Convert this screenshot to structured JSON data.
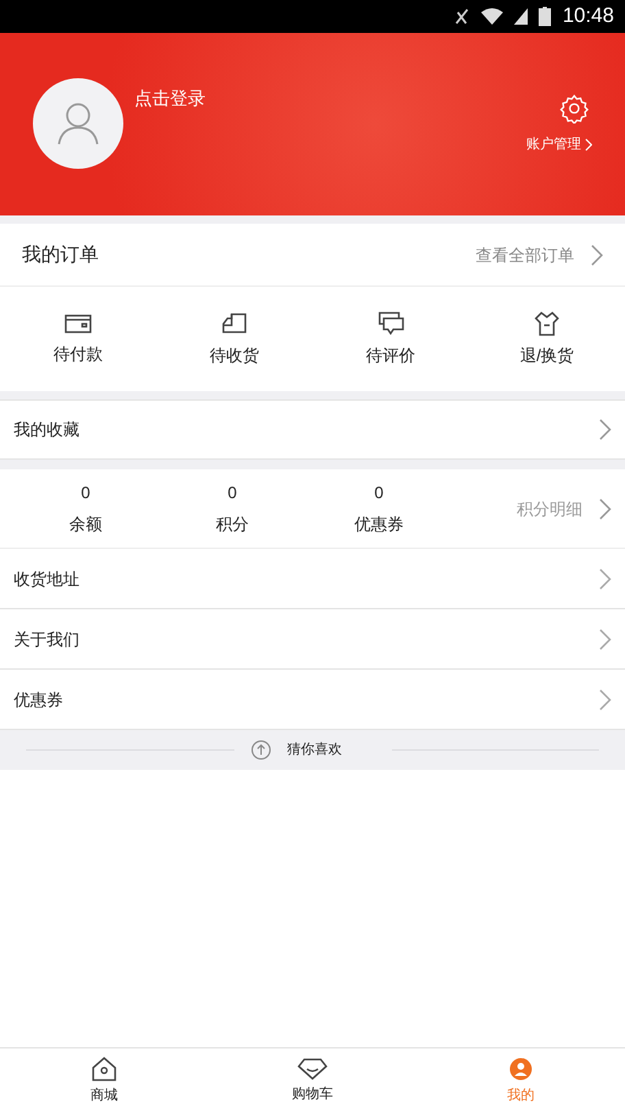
{
  "status_bar": {
    "time": "10:48"
  },
  "profile": {
    "login_text": "点击登录",
    "account_link": "账户管理"
  },
  "orders": {
    "title": "我的订单",
    "view_all": "查看全部订单",
    "shortcuts": [
      {
        "kind": "wallet",
        "label": "待付款"
      },
      {
        "kind": "truck",
        "label": "待收货"
      },
      {
        "kind": "comment",
        "label": "待评价"
      },
      {
        "kind": "return",
        "label": "退/换货"
      }
    ]
  },
  "favorites": {
    "title": "我的收藏"
  },
  "stats": {
    "items": [
      {
        "value": "0",
        "label": "余额"
      },
      {
        "value": "0",
        "label": "积分"
      },
      {
        "value": "0",
        "label": "优惠券"
      }
    ],
    "detail_link": "积分明细"
  },
  "menu": [
    {
      "label": "收货地址"
    },
    {
      "label": "关于我们"
    },
    {
      "label": "优惠券"
    }
  ],
  "recommend": {
    "title": "猜你喜欢"
  },
  "tab_bar": [
    {
      "kind": "home",
      "label": "商城",
      "selected": false
    },
    {
      "kind": "cart",
      "label": "购物车",
      "selected": false
    },
    {
      "kind": "person",
      "label": "我的",
      "selected": true
    }
  ]
}
